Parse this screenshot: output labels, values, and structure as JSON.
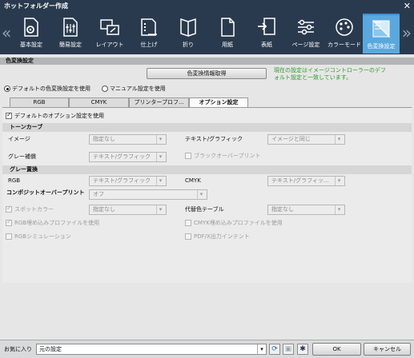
{
  "window": {
    "title": "ホットフォルダー作成",
    "close": "✕"
  },
  "ribbon": {
    "left_arrow": "«",
    "right_arrow": "»",
    "tabs": [
      {
        "label": "基本設定",
        "icon": "gear-document-icon"
      },
      {
        "label": "簡易設定",
        "icon": "sliders-document-icon"
      },
      {
        "label": "レイアウト",
        "icon": "layout-icon"
      },
      {
        "label": "仕上げ",
        "icon": "finishing-icon"
      },
      {
        "label": "折り",
        "icon": "fold-icon"
      },
      {
        "label": "用紙",
        "icon": "paper-icon"
      },
      {
        "label": "表紙",
        "icon": "cover-icon"
      },
      {
        "label": "ページ設定",
        "icon": "page-settings-icon"
      },
      {
        "label": "カラーモード",
        "icon": "palette-icon"
      },
      {
        "label": "色変換設定",
        "icon": "color-conversion-icon"
      }
    ]
  },
  "color_conversion": {
    "section_title": "色変換設定",
    "get_info_button": "色変換情報取得",
    "status_note_line1": "現在の設定はイメージコントローラーのデフ",
    "status_note_line2": "ォルト設定と一致しています。",
    "radio_default": "デフォルトの色変換設定を使用",
    "radio_manual": "マニュアル設定を使用"
  },
  "subtabs": [
    "RGB",
    "CMYK",
    "プリンタープロフ...",
    "オプション設定"
  ],
  "options": {
    "use_default_label": "デフォルトのオプション設定を使用",
    "tone_curve": {
      "group": "トーンカーブ",
      "image_label": "イメージ",
      "image_value": "指定なし",
      "text_graphic_label": "テキスト/グラフィック",
      "text_graphic_value": "イメージと同じ",
      "gray_label": "グレー補償",
      "gray_value": "テキスト/グラフィック",
      "black_overprint": "ブラックオーバープリント"
    },
    "gray_replace": {
      "group": "グレー置換",
      "rgb_label": "RGB",
      "rgb_value": "テキスト/グラフィック",
      "cmyk_label": "CMYK",
      "cmyk_value": "テキスト/グラフィッ..."
    },
    "composite": {
      "label": "コンポジットオーバープリント",
      "value": "オフ"
    },
    "spot_color": {
      "label": "スポットカラー",
      "value": "指定なし"
    },
    "alt_color_table": {
      "label": "代替色テーブル",
      "value": "指定なし"
    },
    "rgb_embedded_profile": "RGB埋め込みプロファイルを使用",
    "cmyk_embedded_profile": "CMYK埋め込みプロファイルを使用",
    "rgb_simulation": "RGBシミュレーション",
    "pdfx_output_intent": "PDF/X出力インテント"
  },
  "bottom": {
    "favorites_label": "お気に入り",
    "favorites_value": "元の設定",
    "ok": "OK",
    "cancel": "キャンセル"
  },
  "colors": {
    "ribbon_bg": "#2a3a4e",
    "active_tab": "#5aa8de",
    "note_green": "#2e9a28"
  }
}
